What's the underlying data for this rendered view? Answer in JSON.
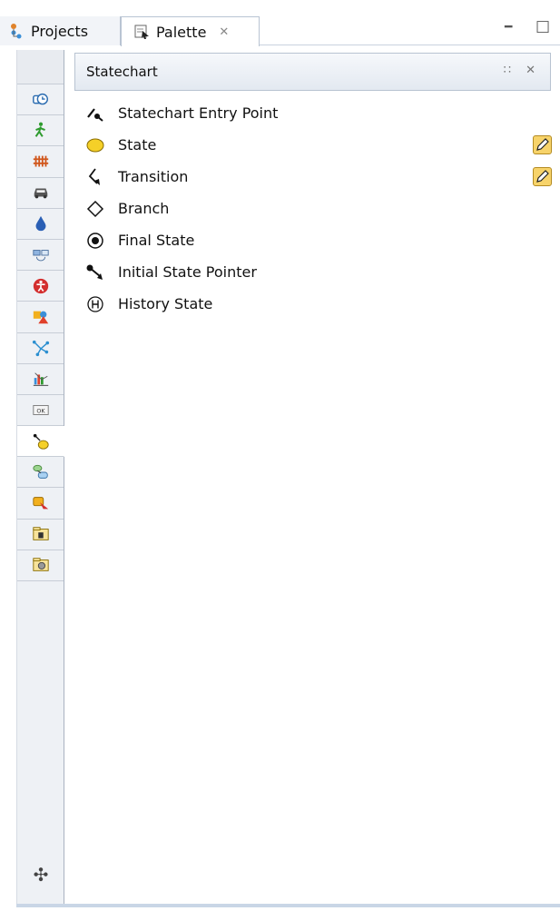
{
  "tabs": [
    {
      "label": "Projects",
      "icon": "projects-icon"
    },
    {
      "label": "Palette",
      "icon": "palette-icon",
      "close": "✕"
    }
  ],
  "window_controls": {
    "minimize": "━",
    "maximize": "□"
  },
  "drawer": {
    "title": "Statechart",
    "tools": "∷ ✕"
  },
  "palette_items": [
    {
      "label": "Statechart Entry Point",
      "icon": "statechart-entry-point-icon",
      "editable": false
    },
    {
      "label": "State",
      "icon": "state-icon",
      "editable": true
    },
    {
      "label": "Transition",
      "icon": "transition-icon",
      "editable": true
    },
    {
      "label": "Branch",
      "icon": "branch-icon",
      "editable": false
    },
    {
      "label": "Final State",
      "icon": "final-state-icon",
      "editable": false
    },
    {
      "label": "Initial State Pointer",
      "icon": "initial-state-pointer-icon",
      "editable": false
    },
    {
      "label": "History State",
      "icon": "history-state-icon",
      "editable": false
    }
  ],
  "strip_icons": [
    "timer-icon",
    "pedestrian-icon",
    "rail-icon",
    "car-icon",
    "fluid-icon",
    "process-icon",
    "accessibility-icon",
    "shapes-icon",
    "network-icon",
    "analysis-chart-icon",
    "ok-button-icon",
    "statechart-icon",
    "agent-icon",
    "actions-icon",
    "presentation-icon",
    "3d-object-icon"
  ],
  "strip_active_index": 11,
  "add_label": "✣",
  "colors": {
    "accent": "#f7d36a",
    "state_fill": "#f5d028",
    "panel_border": "#b8c3d1"
  }
}
